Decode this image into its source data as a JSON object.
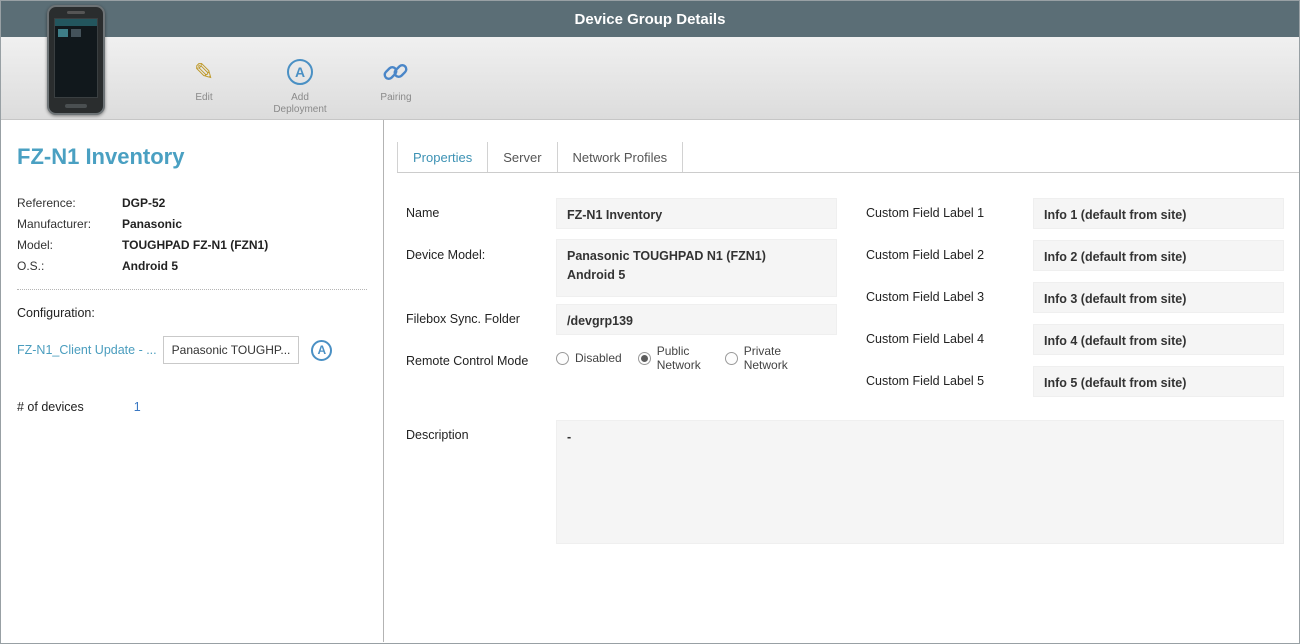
{
  "window": {
    "title": "Device Group Details"
  },
  "toolbar": {
    "actions": [
      {
        "label": "Edit"
      },
      {
        "label": "Add Deployment"
      },
      {
        "label": "Pairing"
      }
    ]
  },
  "device_panel": {
    "title": "FZ-N1 Inventory",
    "fields": [
      {
        "label": "Reference:",
        "value": "DGP-52"
      },
      {
        "label": "Manufacturer:",
        "value": "Panasonic"
      },
      {
        "label": "Model:",
        "value": "TOUGHPAD FZ-N1 (FZN1)"
      },
      {
        "label": "O.S.:",
        "value": "Android 5"
      }
    ],
    "configuration": {
      "label": "Configuration:",
      "link": "FZ-N1_Client Update - ...",
      "value": "Panasonic TOUGHP...",
      "icon": "circled-a-deployment-icon"
    },
    "devices": {
      "label": "# of devices",
      "count": "1"
    }
  },
  "tabs": [
    {
      "label": "Properties",
      "active": true
    },
    {
      "label": "Server",
      "active": false
    },
    {
      "label": "Network Profiles",
      "active": false
    }
  ],
  "form": {
    "name": {
      "label": "Name",
      "value": "FZ-N1 Inventory"
    },
    "device_model": {
      "label": "Device Model:",
      "lines": [
        "Panasonic TOUGHPAD N1 (FZN1)",
        "Android 5"
      ]
    },
    "filebox": {
      "label": "Filebox Sync. Folder",
      "value": "/devgrp139"
    },
    "remote_control": {
      "label": "Remote Control Mode",
      "options": [
        {
          "label": "Disabled",
          "selected": false
        },
        {
          "label": "Public Network",
          "selected": true
        },
        {
          "label": "Private Network",
          "selected": false
        }
      ]
    },
    "description": {
      "label": "Description",
      "value": "-"
    }
  },
  "custom_fields": [
    {
      "label": "Custom Field Label 1",
      "value": "Info 1 (default from site)"
    },
    {
      "label": "Custom Field Label 2",
      "value": "Info 2 (default from site)"
    },
    {
      "label": "Custom Field Label 3",
      "value": "Info 3 (default from site)"
    },
    {
      "label": "Custom Field Label 4",
      "value": "Info 4 (default from site)"
    },
    {
      "label": "Custom Field Label 5",
      "value": "Info 5 (default from site)"
    }
  ],
  "colors": {
    "header_bg": "#5b6e76",
    "accent_teal": "#4aa0c2",
    "link_blue": "#3b78c3",
    "icon_blue": "#4a90c4",
    "pencil_gold": "#bf9a2c",
    "field_bg": "#f5f5f5"
  }
}
